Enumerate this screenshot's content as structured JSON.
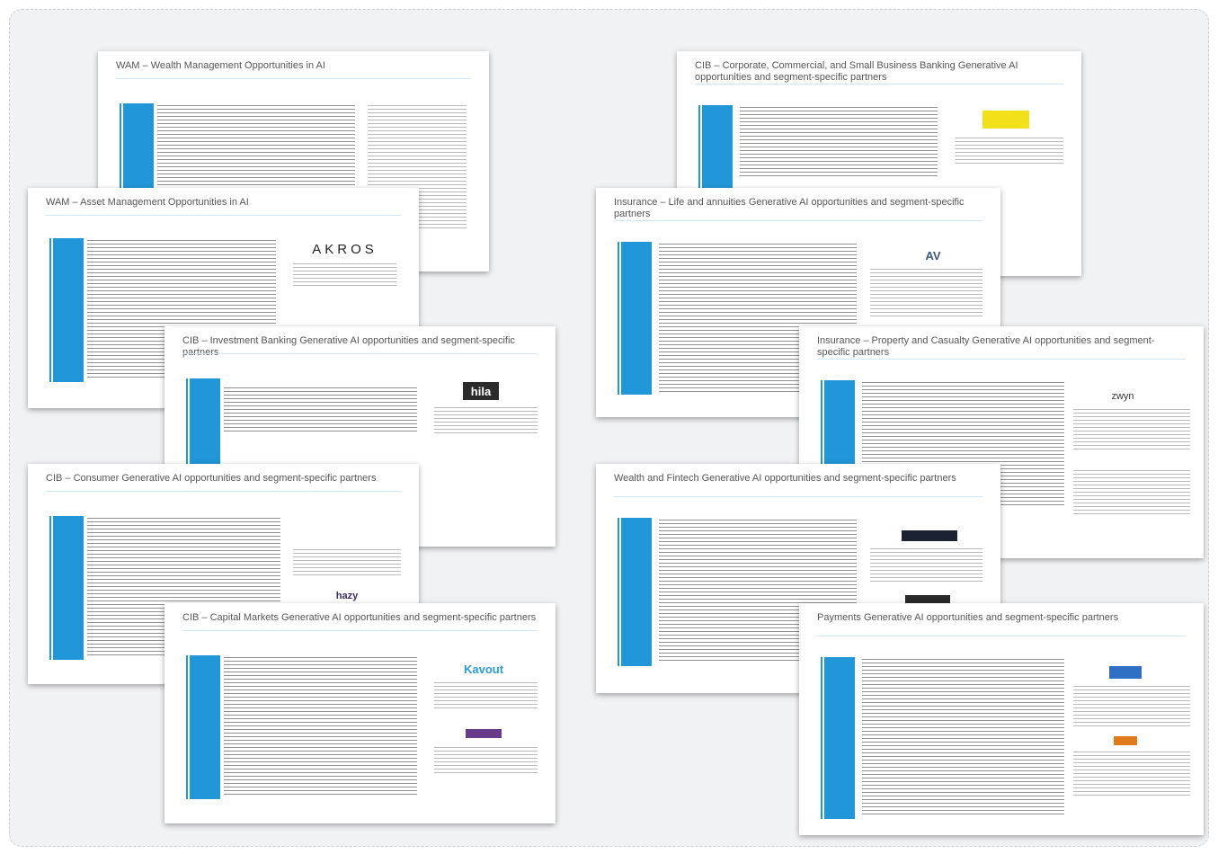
{
  "slides": {
    "wam_wealth": {
      "title": "WAM – Wealth Management Opportunities in AI"
    },
    "cib_corporate": {
      "title": "CIB – Corporate, Commercial, and Small Business Banking Generative AI opportunities and segment-specific partners"
    },
    "wam_asset": {
      "title": "WAM – Asset Management Opportunities in AI",
      "logo_primary": "AKROS"
    },
    "insurance_life": {
      "title": "Insurance – Life and annuities Generative AI opportunities and segment-specific partners",
      "logo_primary": "AV"
    },
    "cib_ib": {
      "title": "CIB – Investment Banking Generative AI opportunities and segment-specific partners",
      "logo_primary": "hila"
    },
    "insurance_pc": {
      "title": "Insurance – Property and Casualty Generative AI opportunities and segment-specific partners",
      "logo_primary": "zwyn"
    },
    "cib_consumer": {
      "title": "CIB – Consumer Generative AI opportunities and segment-specific partners",
      "logo_secondary": "hazy"
    },
    "wealth_fintech": {
      "title": "Wealth and Fintech Generative AI opportunities and segment-specific partners"
    },
    "cib_capital": {
      "title": "CIB – Capital Markets Generative AI opportunities and segment-specific partners",
      "logo_primary": "Kavout"
    },
    "payments": {
      "title": "Payments Generative AI opportunities and segment-specific partners"
    }
  },
  "colors": {
    "band": "#2196d8",
    "background": "#f1f2f4",
    "logo_yellow": "#f2e01a"
  }
}
